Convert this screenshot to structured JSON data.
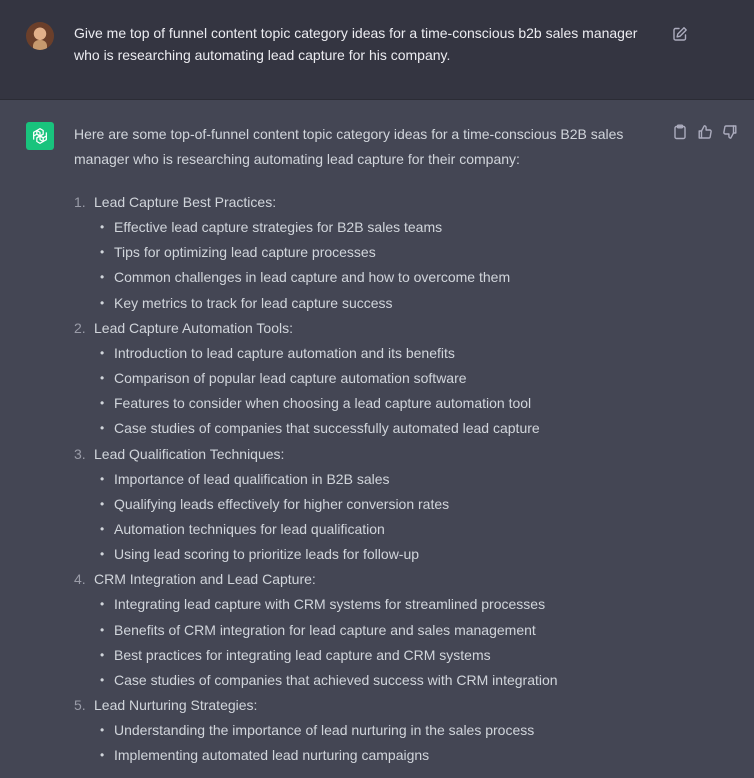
{
  "user_message": {
    "text": "Give me top of funnel content topic category ideas for a time-conscious b2b sales manager who is researching automating lead capture for his company.",
    "avatar_icon": "user-avatar",
    "edit_icon": "edit-icon"
  },
  "assistant_message": {
    "avatar_icon": "openai-logo-icon",
    "intro": "Here are some top-of-funnel content topic category ideas for a time-conscious B2B sales manager who is researching automating lead capture for their company:",
    "actions": [
      "clipboard-icon",
      "thumbs-up-icon",
      "thumbs-down-icon"
    ],
    "categories": [
      {
        "number": "1.",
        "title": "Lead Capture Best Practices:",
        "items": [
          "Effective lead capture strategies for B2B sales teams",
          "Tips for optimizing lead capture processes",
          "Common challenges in lead capture and how to overcome them",
          "Key metrics to track for lead capture success"
        ]
      },
      {
        "number": "2.",
        "title": "Lead Capture Automation Tools:",
        "items": [
          "Introduction to lead capture automation and its benefits",
          "Comparison of popular lead capture automation software",
          "Features to consider when choosing a lead capture automation tool",
          "Case studies of companies that successfully automated lead capture"
        ]
      },
      {
        "number": "3.",
        "title": "Lead Qualification Techniques:",
        "items": [
          "Importance of lead qualification in B2B sales",
          "Qualifying leads effectively for higher conversion rates",
          "Automation techniques for lead qualification",
          "Using lead scoring to prioritize leads for follow-up"
        ]
      },
      {
        "number": "4.",
        "title": "CRM Integration and Lead Capture:",
        "items": [
          "Integrating lead capture with CRM systems for streamlined processes",
          "Benefits of CRM integration for lead capture and sales management",
          "Best practices for integrating lead capture and CRM systems",
          "Case studies of companies that achieved success with CRM integration"
        ]
      },
      {
        "number": "5.",
        "title": "Lead Nurturing Strategies:",
        "items": [
          "Understanding the importance of lead nurturing in the sales process",
          "Implementing automated lead nurturing campaigns"
        ]
      }
    ]
  },
  "colors": {
    "user_bg": "#343541",
    "assistant_bg": "#444654",
    "logo_bg": "#19c37d",
    "text": "#d1d5db"
  }
}
